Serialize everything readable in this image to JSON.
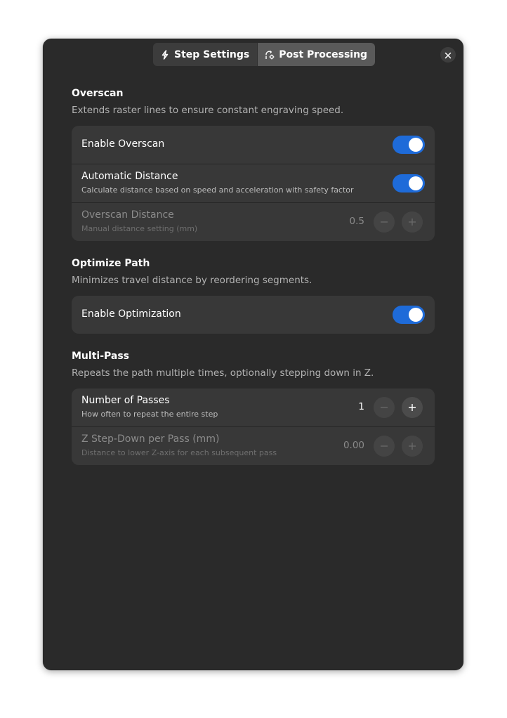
{
  "header": {
    "tabs": [
      {
        "label": "Step Settings",
        "icon": "lightning-icon",
        "active": false
      },
      {
        "label": "Post Processing",
        "icon": "processing-icon",
        "active": true
      }
    ],
    "close_icon": "close-icon"
  },
  "sections": {
    "overscan": {
      "title": "Overscan",
      "description": "Extends raster lines to ensure constant engraving speed.",
      "enable": {
        "title": "Enable Overscan",
        "on": true
      },
      "auto_distance": {
        "title": "Automatic Distance",
        "subtitle": "Calculate distance based on speed and acceleration with safety factor",
        "on": true
      },
      "distance": {
        "title": "Overscan Distance",
        "subtitle": "Manual distance setting (mm)",
        "value": "0.5",
        "disabled": true
      }
    },
    "optimize": {
      "title": "Optimize Path",
      "description": "Minimizes travel distance by reordering segments.",
      "enable": {
        "title": "Enable Optimization",
        "on": true
      }
    },
    "multipass": {
      "title": "Multi-Pass",
      "description": "Repeats the path multiple times, optionally stepping down in Z.",
      "passes": {
        "title": "Number of Passes",
        "subtitle": "How often to repeat the entire step",
        "value": "1"
      },
      "stepdown": {
        "title": "Z Step-Down per Pass (mm)",
        "subtitle": "Distance to lower Z-axis for each subsequent pass",
        "value": "0.00",
        "disabled": true
      }
    }
  },
  "colors": {
    "accent": "#1e6bd9",
    "dialog_bg": "#2a2a2a",
    "card_bg": "#383838"
  }
}
